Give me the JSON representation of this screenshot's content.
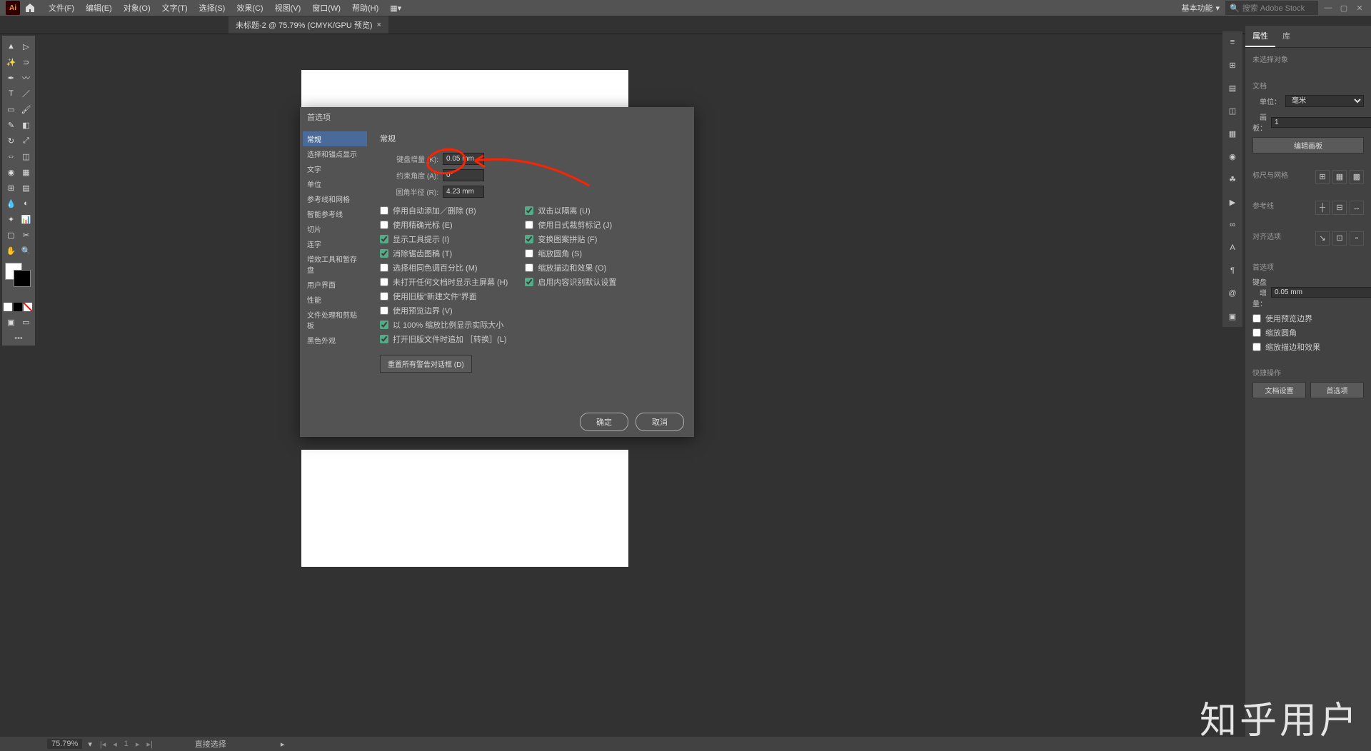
{
  "menu": {
    "items": [
      "文件(F)",
      "编辑(E)",
      "对象(O)",
      "文字(T)",
      "选择(S)",
      "效果(C)",
      "视图(V)",
      "窗口(W)",
      "帮助(H)"
    ],
    "workspace": "基本功能",
    "search_placeholder": "搜索 Adobe Stock"
  },
  "tab": {
    "title": "未标题-2 @ 75.79% (CMYK/GPU 预览)"
  },
  "dialog": {
    "title": "首选项",
    "sidebar": [
      "常规",
      "选择和锚点显示",
      "文字",
      "单位",
      "参考线和网格",
      "智能参考线",
      "切片",
      "连字",
      "增效工具和暂存盘",
      "用户界面",
      "性能",
      "文件处理和剪贴板",
      "黑色外观"
    ],
    "section_title": "常规",
    "fields": {
      "key_increment_label": "键盘增量 (K):",
      "key_increment_value": "0.05 mm",
      "constrain_label": "约束角度 (A):",
      "constrain_value": "0°",
      "corner_label": "圆角半径 (R):",
      "corner_value": "4.23 mm"
    },
    "checks_left": [
      {
        "label": "停用自动添加／删除 (B)",
        "checked": false
      },
      {
        "label": "使用精确光标 (E)",
        "checked": false
      },
      {
        "label": "显示工具提示 (I)",
        "checked": true
      },
      {
        "label": "消除锯齿图稿 (T)",
        "checked": true
      },
      {
        "label": "选择相同色调百分比 (M)",
        "checked": false
      },
      {
        "label": "未打开任何文档时显示主屏幕 (H)",
        "checked": false
      },
      {
        "label": "使用旧版\"新建文件\"界面",
        "checked": false
      },
      {
        "label": "使用预览边界 (V)",
        "checked": false
      },
      {
        "label": "以 100% 缩放比例显示实际大小",
        "checked": true
      },
      {
        "label": "打开旧版文件时追加 ［转换］(L)",
        "checked": true
      }
    ],
    "checks_right": [
      {
        "label": "双击以隔离 (U)",
        "checked": true
      },
      {
        "label": "使用日式裁剪标记 (J)",
        "checked": false
      },
      {
        "label": "变换图案拼贴 (F)",
        "checked": true
      },
      {
        "label": "缩放圆角 (S)",
        "checked": false
      },
      {
        "label": "缩放描边和效果 (O)",
        "checked": false
      },
      {
        "label": "启用内容识别默认设置",
        "checked": true
      }
    ],
    "reset_btn": "重置所有警告对话框 (D)",
    "ok": "确定",
    "cancel": "取消"
  },
  "props": {
    "tab_props": "属性",
    "tab_lib": "库",
    "no_selection": "未选择对象",
    "doc_label": "文档",
    "unit_label": "单位：",
    "unit_value": "毫米",
    "artboard_label": "画板：",
    "artboard_value": "1",
    "edit_artboards": "编辑画板",
    "rulers_label": "标尺与网格",
    "guides_label": "参考线",
    "snap_label": "对齐选项",
    "prefs_label": "首选项",
    "key_inc_label": "键盘增量：",
    "key_inc_value": "0.05 mm",
    "chk1": "使用预览边界",
    "chk2": "缩放圆角",
    "chk3": "缩放描边和效果",
    "quick_label": "快捷操作",
    "doc_setup": "文档设置",
    "prefs_btn": "首选项"
  },
  "status": {
    "zoom": "75.79%",
    "artboard": "1",
    "mode": "直接选择"
  },
  "watermark": "知乎用户"
}
